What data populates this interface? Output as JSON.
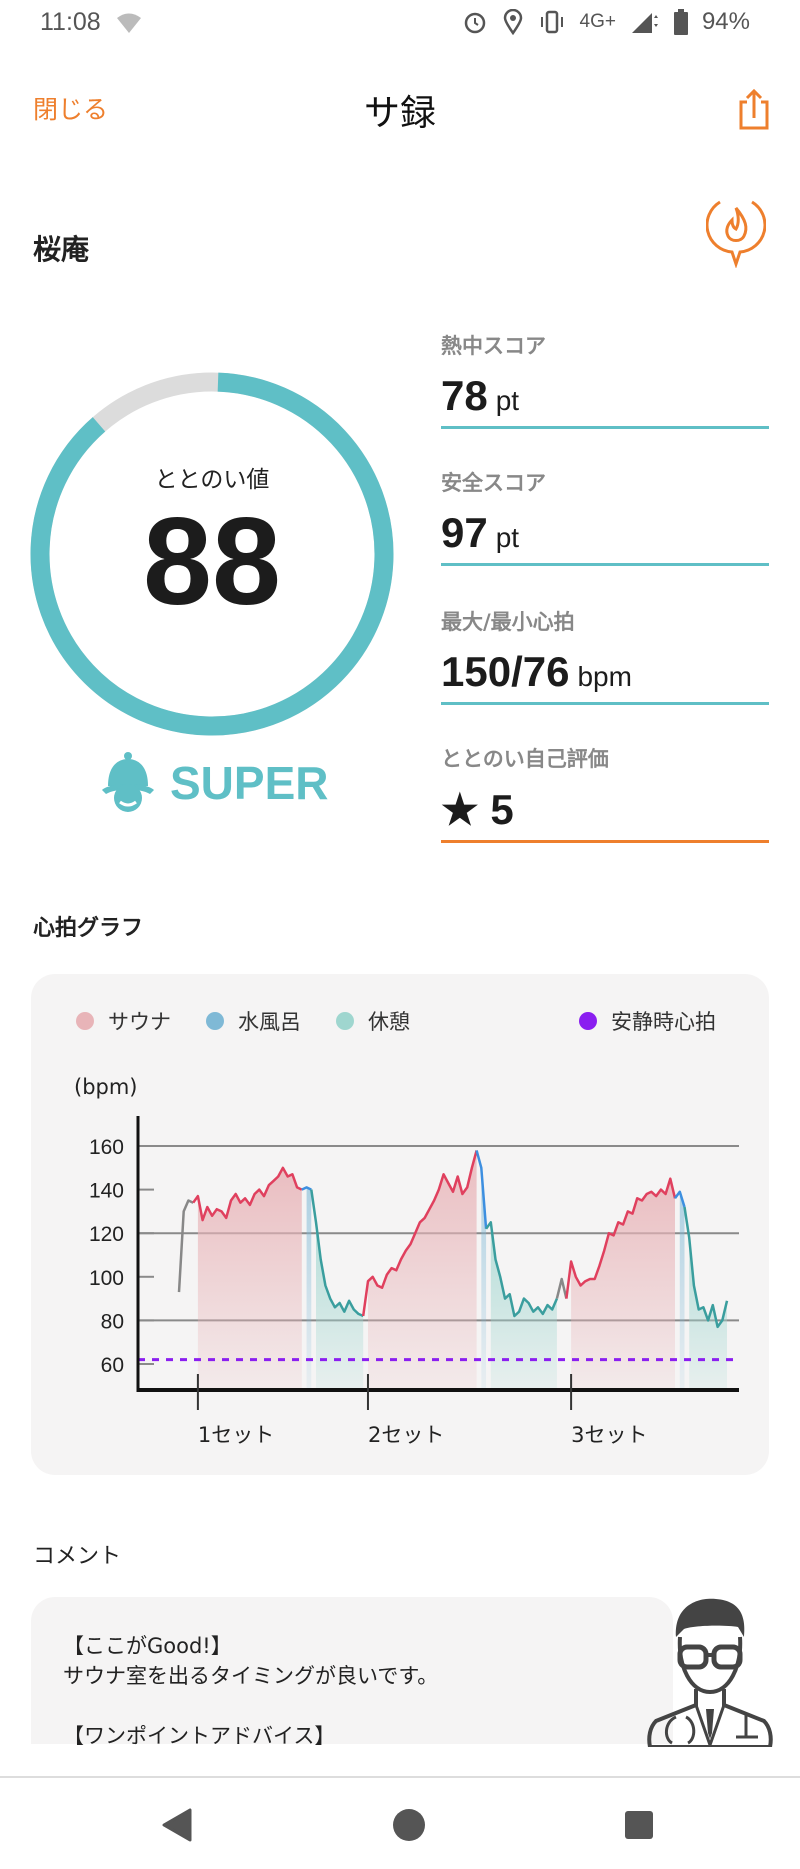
{
  "status_bar": {
    "time": "11:08",
    "network": "4G+",
    "battery": "94%",
    "icons": [
      "wifi-unknown-icon",
      "alarm-icon",
      "location-icon",
      "vibrate-icon",
      "signal-icon",
      "battery-icon"
    ]
  },
  "header": {
    "close_label": "閉じる",
    "title": "サ録",
    "share_icon": "share-icon"
  },
  "facility": {
    "name": "桜庵",
    "icon": "sauna-flame-pin-icon"
  },
  "totonoi": {
    "label": "ととのい値",
    "value": "88",
    "percent": 88,
    "rank": "SUPER",
    "rank_icon": "sauna-hat-face-icon"
  },
  "stats": [
    {
      "label": "熱中スコア",
      "value": "78",
      "unit": "pt"
    },
    {
      "label": "安全スコア",
      "value": "97",
      "unit": "pt"
    },
    {
      "label": "最大/最小心拍",
      "value": "150/76",
      "unit": "bpm"
    },
    {
      "label": "ととのい自己評価",
      "value": "★ 5",
      "unit": ""
    }
  ],
  "heart_section": {
    "title": "心拍グラフ"
  },
  "colors": {
    "accent": "#ee7f2d",
    "teal": "#5fbfc6",
    "gray_track": "#dcdcdc",
    "sauna_fill": "#e8b4b8",
    "sauna_line": "#e0405e",
    "water_fill": "#7fb9d6",
    "water_line": "#3d8fe0",
    "rest_fill": "#9fd6cf",
    "rest_line": "#3a9e9e",
    "other_line": "#888888",
    "resting": "#8a1ef0"
  },
  "chart_data": {
    "type": "area",
    "ylabel": "(bpm)",
    "ylim": [
      48,
      172
    ],
    "yticks": [
      60,
      80,
      100,
      120,
      140,
      160
    ],
    "grid_lines": [
      80,
      120,
      160
    ],
    "legend": [
      {
        "name": "サウナ",
        "color": "#e8b4b8"
      },
      {
        "name": "水風呂",
        "color": "#7fb9d6"
      },
      {
        "name": "休憩",
        "color": "#9fd6cf"
      },
      {
        "name": "安静時心拍",
        "color": "#8a1ef0"
      }
    ],
    "legend_placement": "top",
    "resting_hr": 62,
    "set_labels": [
      "1セット",
      "2セット",
      "3セット"
    ],
    "segments": [
      {
        "phase": "other",
        "values": [
          93,
          130,
          135,
          134
        ]
      },
      {
        "phase": "sauna",
        "values": [
          137,
          126,
          132,
          128,
          131,
          130,
          127,
          135,
          138,
          134,
          136,
          133,
          138,
          140,
          137,
          142,
          144,
          146,
          150,
          146,
          147,
          141,
          140
        ]
      },
      {
        "phase": "water",
        "values": [
          141,
          140
        ]
      },
      {
        "phase": "rest",
        "values": [
          125,
          108,
          96,
          90,
          86,
          88,
          84,
          89,
          85,
          83,
          82
        ]
      },
      {
        "phase": "sauna",
        "values": [
          98,
          100,
          96,
          95,
          101,
          104,
          103,
          108,
          112,
          115,
          120,
          125,
          127,
          131,
          135,
          140,
          147,
          143,
          139,
          146,
          138,
          141,
          150,
          158
        ]
      },
      {
        "phase": "water",
        "values": [
          150,
          122
        ]
      },
      {
        "phase": "rest",
        "values": [
          125,
          108,
          100,
          90,
          92,
          82,
          84,
          90,
          88,
          84,
          86,
          83,
          87,
          85,
          90
        ]
      },
      {
        "phase": "other",
        "values": [
          99,
          90
        ]
      },
      {
        "phase": "sauna",
        "values": [
          107,
          100,
          96,
          98,
          99,
          99,
          105,
          112,
          120,
          119,
          125,
          124,
          130,
          129,
          136,
          135,
          138,
          139,
          137,
          140,
          138,
          145,
          136
        ]
      },
      {
        "phase": "water",
        "values": [
          139,
          132
        ]
      },
      {
        "phase": "rest",
        "values": [
          118,
          96,
          85,
          86,
          80,
          87,
          77,
          80,
          89
        ]
      }
    ]
  },
  "comment": {
    "title": "コメント",
    "good_heading": "【ここがGood!】",
    "good_text": "サウナ室を出るタイミングが良いです。",
    "advice_heading": "【ワンポイントアドバイス】",
    "avatar_icon": "doctor-avatar-icon"
  },
  "nav": {
    "icons": [
      "back-icon",
      "home-icon",
      "recents-icon"
    ]
  }
}
